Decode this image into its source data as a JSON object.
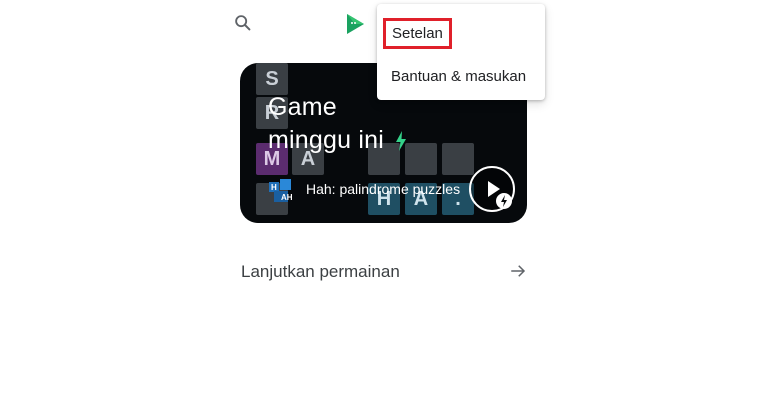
{
  "toolbar": {
    "search_icon": "search-icon",
    "logo_icon": "play-games-logo-icon"
  },
  "menu": {
    "items": [
      {
        "label": "Setelan",
        "highlighted": true
      },
      {
        "label": "Bantuan & masukan"
      }
    ]
  },
  "featured": {
    "title_line1": "Game",
    "title_line2": "minggu ini",
    "game_name": "Hah: palindrome puzzles",
    "tiles": [
      "S",
      "R",
      "M",
      "A",
      "H",
      "A",
      "."
    ],
    "colors": {
      "accent_bolt": "#34d28a",
      "highlight": "#e0202a"
    }
  },
  "continue": {
    "label": "Lanjutkan permainan"
  }
}
